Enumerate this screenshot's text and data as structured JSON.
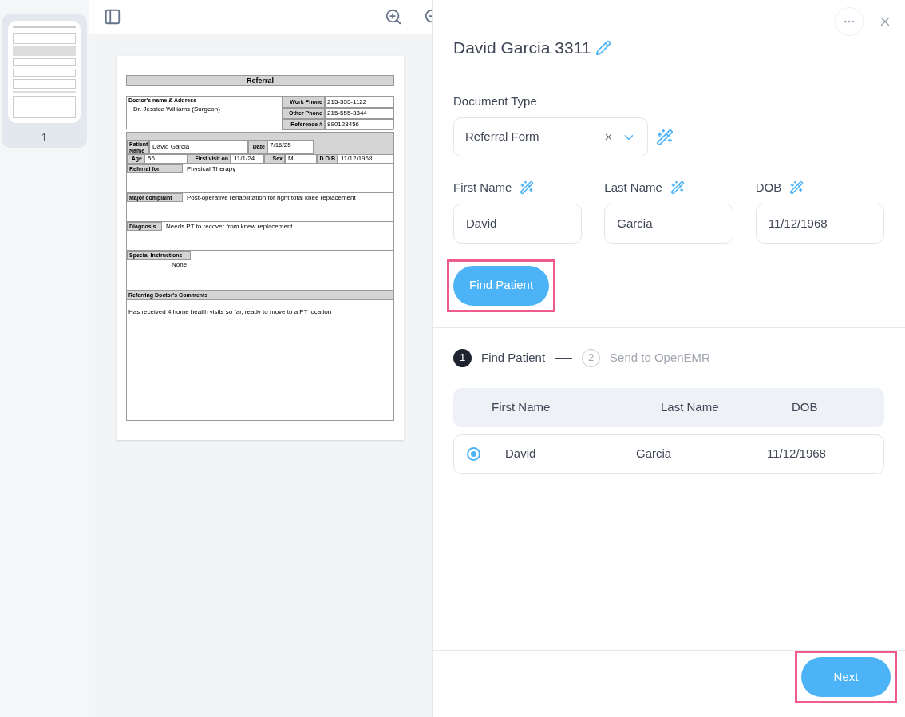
{
  "thumbnails": [
    {
      "page": "1",
      "selected": true
    }
  ],
  "document": {
    "title": "Referral",
    "doctor": {
      "label": "Doctor's name & Address",
      "value": "Dr. Jessica Williams (Surgeon)"
    },
    "contacts": [
      {
        "label": "Work Phone",
        "value": "215-555-1122"
      },
      {
        "label": "Other Phone",
        "value": "215-555-3344"
      },
      {
        "label": "Reference #",
        "value": "890123456"
      }
    ],
    "patient": {
      "name_label": "Patient Name",
      "name": "David Garcia",
      "date_label": "Date",
      "date": "7/16/25"
    },
    "details": [
      {
        "label": "Age",
        "value": "56"
      },
      {
        "label": "First visit on",
        "value": "11/1/24"
      },
      {
        "label": "Sex",
        "value": "M"
      },
      {
        "label": "D O B",
        "value": "11/12/1968"
      }
    ],
    "sections": [
      {
        "label": "Referral for",
        "value": "Physical Therapy"
      },
      {
        "label": "Major complaint",
        "value": "Post-operative rehabilitation for right total knee replacement"
      },
      {
        "label": "Diagnosis",
        "value": "Needs PT to recover from knew replacement"
      },
      {
        "label": "Special Instructions",
        "value": "None"
      }
    ],
    "comments": {
      "label": "Referring Doctor's Comments",
      "value": "Has received 4 home health visits so far, ready to move to a PT location"
    }
  },
  "panel": {
    "title": "David Garcia 3311",
    "document_type": {
      "label": "Document Type",
      "value": "Referral Form"
    },
    "fields": [
      {
        "label": "First Name",
        "value": "David"
      },
      {
        "label": "Last Name",
        "value": "Garcia"
      },
      {
        "label": "DOB",
        "value": "11/12/1968"
      }
    ],
    "find_button": {
      "label": "Find Patient",
      "highlighted": true
    },
    "steps": [
      {
        "number": "1",
        "label": "Find Patient",
        "active": true
      },
      {
        "number": "2",
        "label": "Send to OpenEMR",
        "active": false
      }
    ],
    "table": {
      "columns": [
        "First Name",
        "Last Name",
        "DOB"
      ],
      "rows": [
        {
          "cells": [
            "David",
            "Garcia",
            "11/12/1968"
          ],
          "selected": true
        }
      ]
    },
    "next_button": {
      "label": "Next",
      "highlighted": true
    }
  }
}
